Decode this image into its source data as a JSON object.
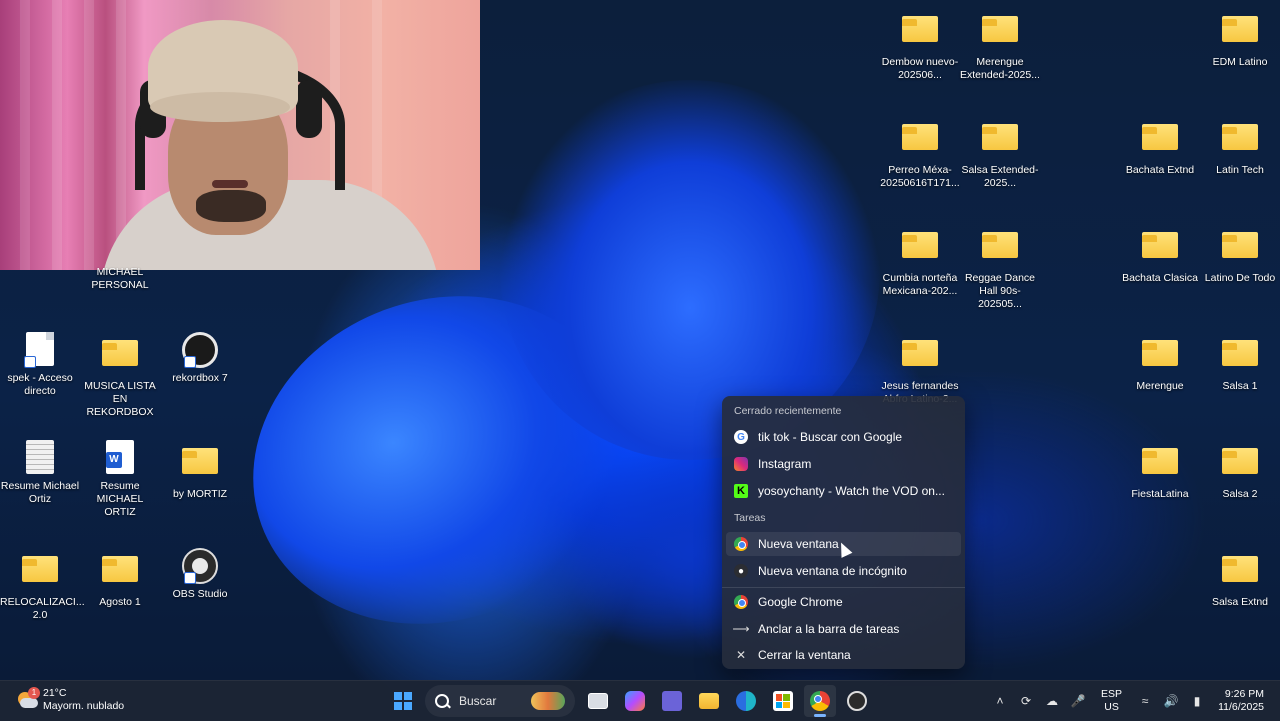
{
  "desktop": {
    "left_icons": [
      {
        "label": "Resume Michael Ortiz",
        "type": "doc"
      },
      {
        "label": "Resume MICHAEL ORTIZ",
        "type": "word"
      },
      {
        "label": "by MORTIZ",
        "type": "folder"
      },
      {
        "label": "spek - Acceso directo",
        "type": "file"
      },
      {
        "label": "MUSICA LISTA EN REKORDBOX",
        "type": "folder"
      },
      {
        "label": "rekordbox 7",
        "type": "app"
      },
      {
        "label": "RELOCALIZACI... 2.0",
        "type": "folder"
      },
      {
        "label": "Agosto 1",
        "type": "folder"
      },
      {
        "label": "OBS Studio",
        "type": "app"
      },
      {
        "label": "MICHAEL PERSONAL",
        "type": "folder"
      }
    ],
    "right_icons": [
      {
        "label": "Dembow nuevo-202506..."
      },
      {
        "label": "Merengue Extended-2025..."
      },
      {
        "label": "EDM Latino"
      },
      {
        "label": "Perreo Méxa-20250616T171..."
      },
      {
        "label": "Salsa Extended-2025..."
      },
      {
        "label": "Bachata Extnd"
      },
      {
        "label": "Latin Tech"
      },
      {
        "label": "Cumbia norteña Mexicana-202..."
      },
      {
        "label": "Reggae Dance Hall 90s-202505..."
      },
      {
        "label": "Bachata Clasica"
      },
      {
        "label": "Latino De Todo"
      },
      {
        "label": "Jesus fernandes Abfro Latino-2..."
      },
      {
        "label": "Merengue"
      },
      {
        "label": "Salsa 1"
      },
      {
        "label": "FiestaLatina"
      },
      {
        "label": "Salsa 2"
      },
      {
        "label": "Salsa Extnd"
      }
    ]
  },
  "jumplist": {
    "recent_header": "Cerrado recientemente",
    "recent": [
      {
        "label": "tik tok - Buscar con Google",
        "icon": "google-icon"
      },
      {
        "label": "Instagram",
        "icon": "instagram-icon"
      },
      {
        "label": "yosoychanty - Watch the VOD on...",
        "icon": "kick-icon"
      }
    ],
    "tasks_header": "Tareas",
    "tasks": [
      {
        "label": "Nueva ventana",
        "icon": "chrome-icon"
      },
      {
        "label": "Nueva ventana de incógnito",
        "icon": "incognito-icon"
      }
    ],
    "actions": [
      {
        "label": "Google Chrome",
        "icon": "chrome-icon"
      },
      {
        "label": "Anclar a la barra de tareas",
        "icon": "pin-icon"
      },
      {
        "label": "Cerrar la ventana",
        "icon": "close-icon"
      }
    ]
  },
  "taskbar": {
    "weather": {
      "temp": "21°C",
      "desc": "Mayorm. nublado",
      "badge": "1"
    },
    "search_placeholder": "Buscar",
    "lang_top": "ESP",
    "lang_bottom": "US",
    "time": "9:26 PM",
    "date": "11/6/2025"
  }
}
